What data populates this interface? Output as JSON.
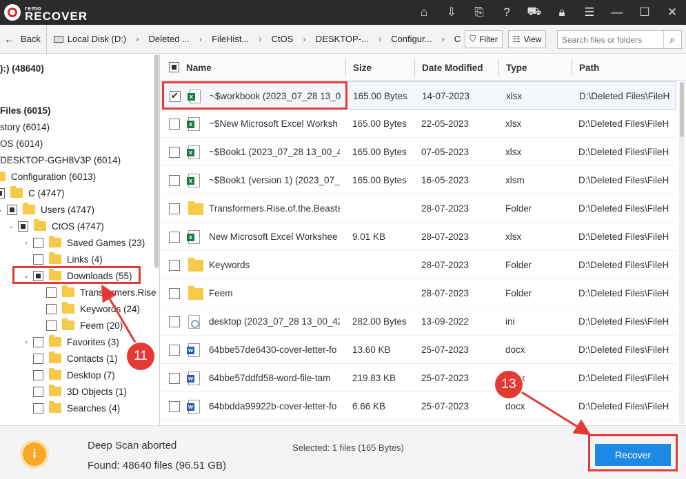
{
  "app": {
    "logo_small": "remo",
    "logo_big": "RECOVER"
  },
  "titlebar_icons": [
    "home-icon",
    "export-icon",
    "file-export-icon",
    "help-icon",
    "cart-icon",
    "lock-icon",
    "menu-icon",
    "minimize-icon",
    "maximize-icon",
    "close-icon"
  ],
  "nav": {
    "back_label": "Back",
    "breadcrumbs": [
      "Local Disk (D:)",
      "Deleted ...",
      "FileHist...",
      "CtOS",
      "DESKTOP-...",
      "Configur...",
      "C"
    ],
    "filter_label": "Filter",
    "view_label": "View",
    "search_placeholder": "Search files or folders"
  },
  "tree": [
    {
      "label": "):) (48640)"
    },
    {
      "label": ""
    },
    {
      "label": "Files (6015)"
    },
    {
      "label": "story (6014)"
    },
    {
      "label": "OS (6014)"
    },
    {
      "label": "DESKTOP-GGH8V3P (6014)"
    },
    {
      "label": "Configuration (6013)"
    },
    {
      "label": "C (4747)"
    },
    {
      "label": "Users (4747)"
    },
    {
      "label": "CtOS (4747)"
    },
    {
      "label": "Saved Games (23)"
    },
    {
      "label": "Links (4)"
    },
    {
      "label": "Downloads (55)"
    },
    {
      "label": "Transformers.Rise"
    },
    {
      "label": "Keywords (24)"
    },
    {
      "label": "Feem (20)"
    },
    {
      "label": "Favorites (3)"
    },
    {
      "label": "Contacts (1)"
    },
    {
      "label": "Desktop (7)"
    },
    {
      "label": "3D Objects (1)"
    },
    {
      "label": "Searches (4)"
    }
  ],
  "table": {
    "headers": {
      "name": "Name",
      "size": "Size",
      "modified": "Date Modified",
      "type": "Type",
      "path": "Path"
    },
    "rows": [
      {
        "name": "~$workbook (2023_07_28 13_0",
        "size": "165.00 Bytes",
        "date": "14-07-2023",
        "type": "xlsx",
        "path": "D:\\Deleted Files\\FileH",
        "icon": "xls",
        "checked": true
      },
      {
        "name": "~$New Microsoft Excel Worksh",
        "size": "165.00 Bytes",
        "date": "22-05-2023",
        "type": "xlsx",
        "path": "D:\\Deleted Files\\FileH",
        "icon": "xls",
        "checked": false
      },
      {
        "name": "~$Book1 (2023_07_28 13_00_4",
        "size": "165.00 Bytes",
        "date": "07-05-2023",
        "type": "xlsx",
        "path": "D:\\Deleted Files\\FileH",
        "icon": "xls",
        "checked": false
      },
      {
        "name": "~$Book1 (version 1) (2023_07_",
        "size": "165.00 Bytes",
        "date": "16-05-2023",
        "type": "xlsm",
        "path": "D:\\Deleted Files\\FileH",
        "icon": "xls",
        "checked": false
      },
      {
        "name": "Transformers.Rise.of.the.Beasts.",
        "size": "",
        "date": "28-07-2023",
        "type": "Folder",
        "path": "D:\\Deleted Files\\FileH",
        "icon": "fold",
        "checked": false
      },
      {
        "name": "New Microsoft Excel Workshee",
        "size": "9.01 KB",
        "date": "28-07-2023",
        "type": "xlsx",
        "path": "D:\\Deleted Files\\FileH",
        "icon": "xls",
        "checked": false
      },
      {
        "name": "Keywords",
        "size": "",
        "date": "28-07-2023",
        "type": "Folder",
        "path": "D:\\Deleted Files\\FileH",
        "icon": "fold",
        "checked": false
      },
      {
        "name": "Feem",
        "size": "",
        "date": "28-07-2023",
        "type": "Folder",
        "path": "D:\\Deleted Files\\FileH",
        "icon": "fold",
        "checked": false
      },
      {
        "name": "desktop (2023_07_28 13_00_42",
        "size": "282.00 Bytes",
        "date": "13-09-2022",
        "type": "ini",
        "path": "D:\\Deleted Files\\FileH",
        "icon": "ini",
        "checked": false
      },
      {
        "name": "64bbe57de6430-cover-letter-fo",
        "size": "13.60 KB",
        "date": "25-07-2023",
        "type": "docx",
        "path": "D:\\Deleted Files\\FileH",
        "icon": "doc",
        "checked": false
      },
      {
        "name": "64bbe57ddfd58-word-file-tam",
        "size": "219.83 KB",
        "date": "25-07-2023",
        "type": "docx",
        "path": "D:\\Deleted Files\\FileH",
        "icon": "doc",
        "checked": false
      },
      {
        "name": "64bbdda99922b-cover-letter-fo",
        "size": "6.66 KB",
        "date": "25-07-2023",
        "type": "docx",
        "path": "D:\\Deleted Files\\FileH",
        "icon": "doc",
        "checked": false
      }
    ]
  },
  "status": {
    "title": "Deep Scan aborted",
    "found": "Found: 48640 files (96.51 GB)",
    "selected": "Selected: 1 files (165 Bytes)",
    "info_icon": "i"
  },
  "recover_label": "Recover",
  "annotations": {
    "marker_11": "11",
    "marker_13": "13"
  },
  "colors": {
    "accent": "#1e88e5",
    "annotation": "#e53935",
    "titlebar": "#2b2b2b",
    "folder": "#f7c948"
  }
}
